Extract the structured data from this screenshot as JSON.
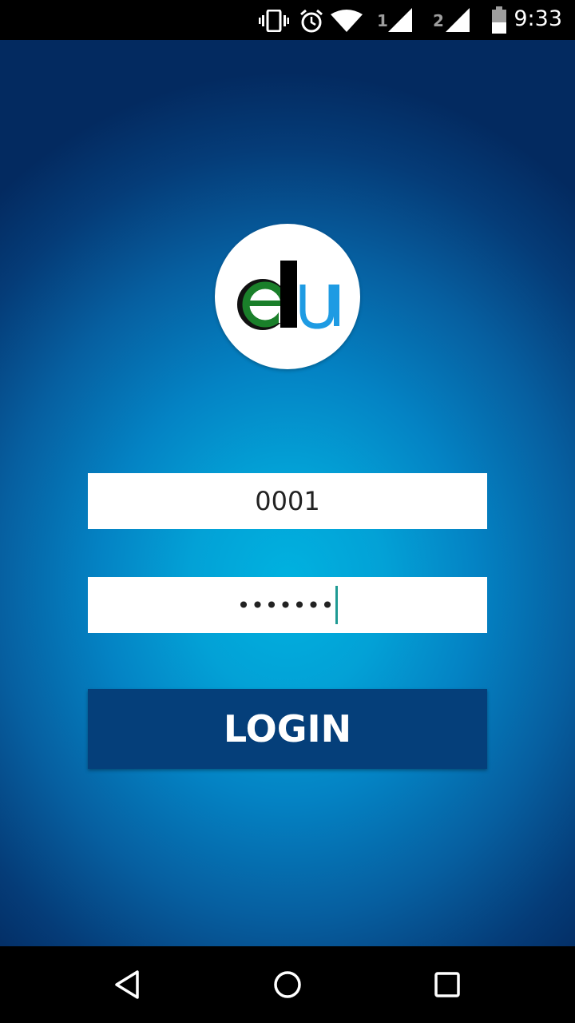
{
  "status_bar": {
    "time": "9:33",
    "sim1_label": "1",
    "sim2_label": "2",
    "icons": [
      "vibrate-icon",
      "alarm-icon",
      "wifi-icon",
      "signal-sim1-icon",
      "signal-sim2-icon",
      "battery-icon"
    ]
  },
  "logo": {
    "text": "edu",
    "colors": {
      "e": "#1a7f2a",
      "d": "#000000",
      "u": "#1e9be3"
    }
  },
  "login_form": {
    "username_value": "0001",
    "password_masked": "•••••••",
    "login_label": "LOGIN"
  },
  "colors": {
    "button_bg": "#053f7a",
    "cursor": "#1e9a93",
    "background_center": "#00b2e0",
    "background_edge": "#032a60"
  },
  "nav_bar": {
    "icons": [
      "back-icon",
      "home-icon",
      "recents-icon"
    ]
  }
}
